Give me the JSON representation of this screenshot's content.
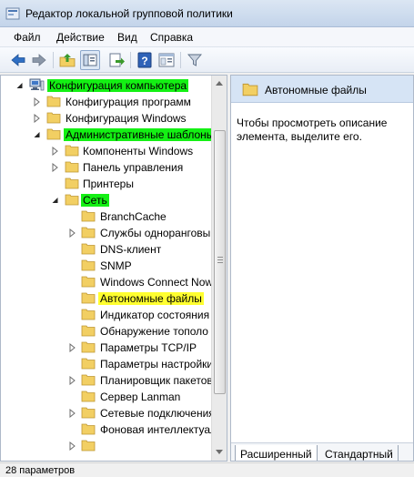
{
  "window": {
    "title": "Редактор локальной групповой политики"
  },
  "menu": {
    "items": [
      "Файл",
      "Действие",
      "Вид",
      "Справка"
    ]
  },
  "toolbar": {
    "buttons": [
      "back-arrow-icon",
      "forward-arrow-icon",
      "up-folder-icon",
      "show-hide-tree-icon",
      "export-list-icon",
      "help-icon",
      "properties-icon",
      "filter-icon"
    ]
  },
  "tree": {
    "items": [
      {
        "label": "Конфигурация компьютера",
        "highlight": "green"
      },
      {
        "label": "Конфигурация программ"
      },
      {
        "label": "Конфигурация Windows"
      },
      {
        "label": "Административные шаблоны",
        "highlight": "green"
      },
      {
        "label": "Компоненты Windows"
      },
      {
        "label": "Панель управления"
      },
      {
        "label": "Принтеры"
      },
      {
        "label": "Сеть",
        "highlight": "green"
      },
      {
        "label": "BranchCache"
      },
      {
        "label": "Службы одноранговы"
      },
      {
        "label": "DNS-клиент"
      },
      {
        "label": "SNMP"
      },
      {
        "label": "Windows Connect Now"
      },
      {
        "label": "Автономные файлы",
        "highlight": "yellow",
        "selected": true
      },
      {
        "label": "Индикатор состояния"
      },
      {
        "label": "Обнаружение тополо"
      },
      {
        "label": "Параметры TCP/IP"
      },
      {
        "label": "Параметры настройки"
      },
      {
        "label": "Планировщик пакетов"
      },
      {
        "label": "Сервер Lanman"
      },
      {
        "label": "Сетевые подключения"
      },
      {
        "label": "Фоновая интеллектуал"
      }
    ]
  },
  "details": {
    "title": "Автономные файлы",
    "description": "Чтобы просмотреть описание элемента, выделите его.",
    "tabs": [
      "Расширенный",
      "Стандартный"
    ]
  },
  "status": {
    "text": "28 параметров"
  },
  "colors": {
    "highlight_green": "#14f014",
    "highlight_yellow": "#ffff30",
    "folder": "#f2cf63",
    "header": "#d6e4f5"
  }
}
